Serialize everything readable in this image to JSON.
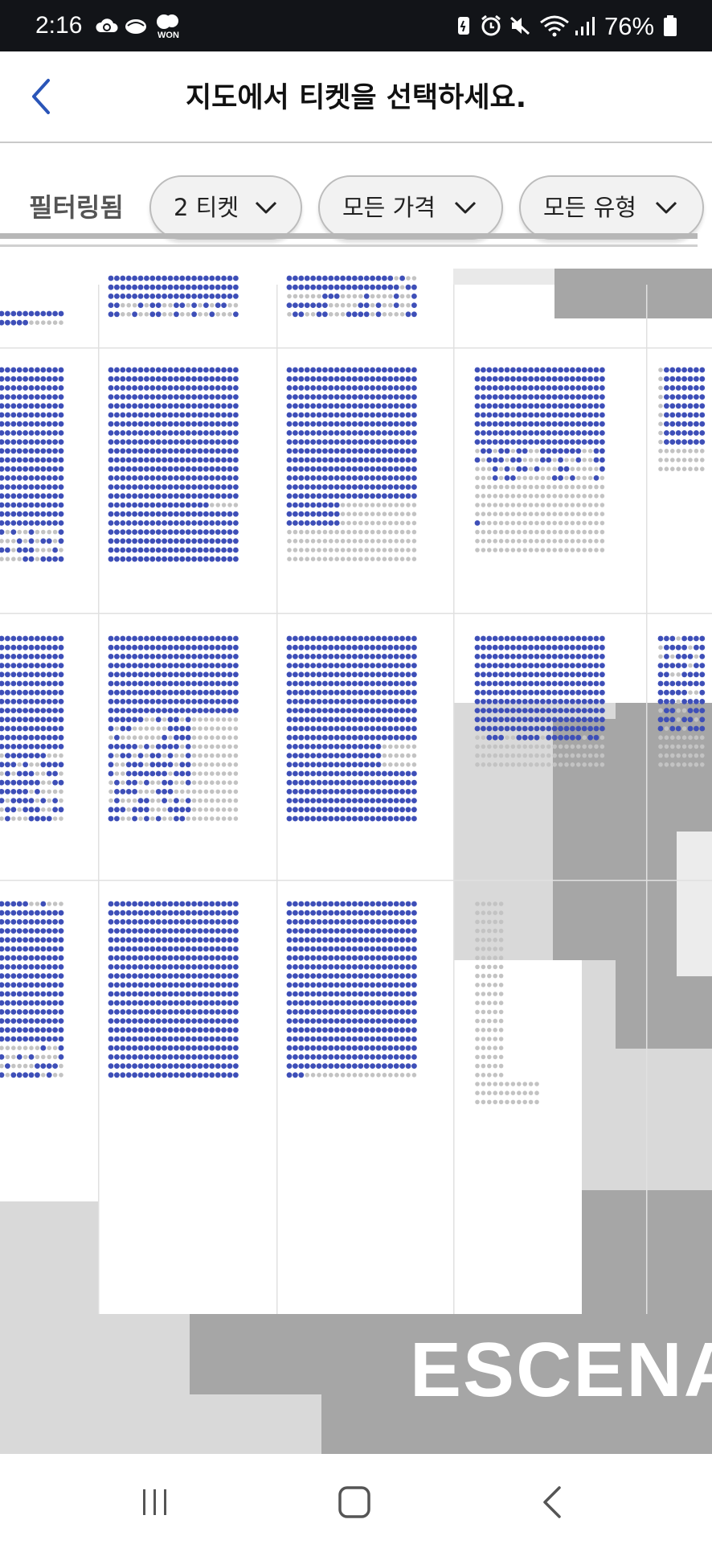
{
  "status_bar": {
    "time": "2:16",
    "battery": "76%",
    "notification_icons": [
      "cloud-sync-icon",
      "cloud-icon",
      "won-icon"
    ],
    "won_badge": "WON",
    "system_icons": [
      "battery-saver-icon",
      "alarm-icon",
      "mute-icon",
      "wifi-icon",
      "signal-icon",
      "battery-icon"
    ]
  },
  "header": {
    "title": "지도에서 티켓을 선택하세요.",
    "back_icon": "chevron-left-icon"
  },
  "filters": {
    "label": "필터링됨",
    "quantity": "2 티켓",
    "price": "모든 가격",
    "type": "모든 유형"
  },
  "seat_map": {
    "stage_label": "ESCENA",
    "colors": {
      "available": "#3e4fb8",
      "unavailable": "#c3c3c3",
      "section_bg": "#ffffff",
      "venue_light": "#d9d9d9",
      "venue_dark": "#a6a6a6"
    }
  },
  "nav_bar": {
    "buttons": [
      "recent-apps-icon",
      "home-icon",
      "back-icon"
    ]
  }
}
